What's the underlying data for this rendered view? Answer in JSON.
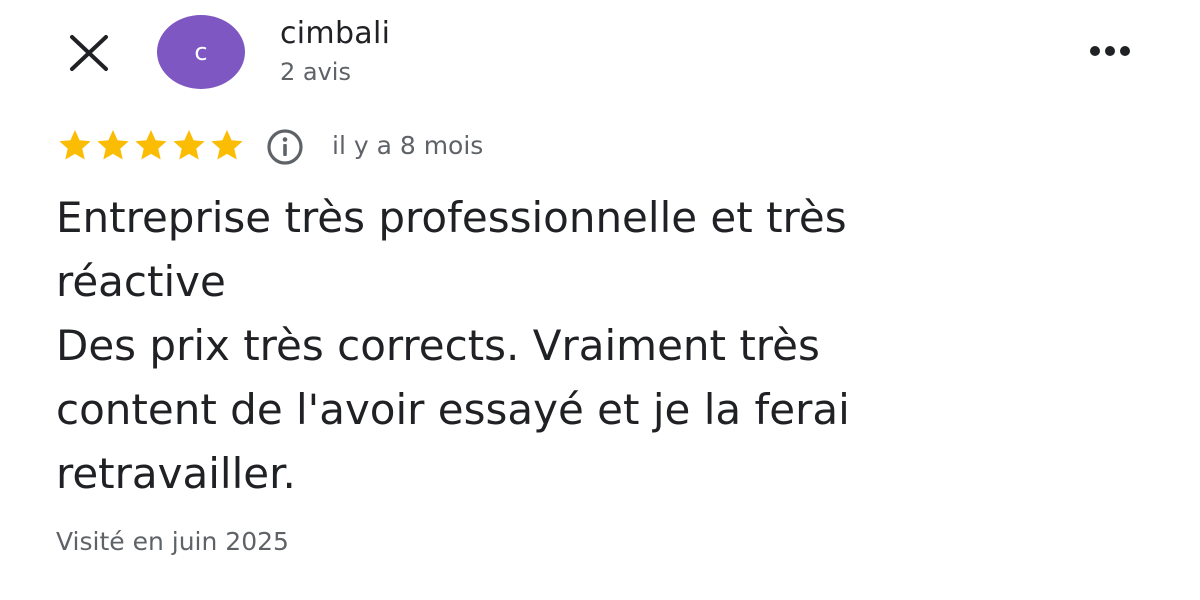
{
  "header": {
    "avatar_initial": "c",
    "avatar_color": "#7e57c2",
    "author_name": "cimbali",
    "author_reviews": "2 avis",
    "close_icon": "close-icon",
    "more_icon": "more-horizontal-icon"
  },
  "review": {
    "rating": 5,
    "rating_max": 5,
    "star_color": "#fbbc04",
    "info_icon": "info-icon",
    "date": "il y a 8 mois",
    "text_lines": [
      "Entreprise très professionnelle et très",
      "réactive",
      "Des prix très corrects. Vraiment très",
      "content de l'avoir essayé et je la ferai",
      "retravailler."
    ],
    "visited": "Visité en juin 2025"
  }
}
